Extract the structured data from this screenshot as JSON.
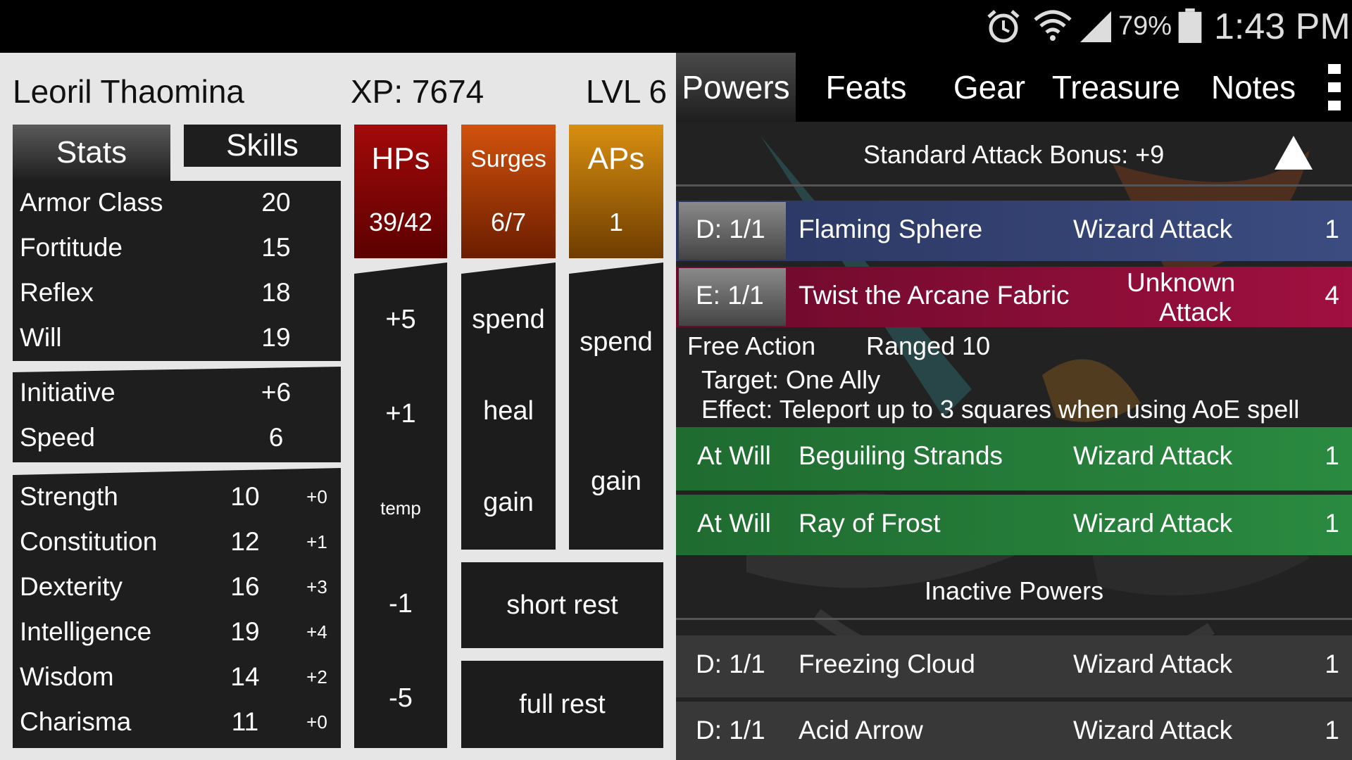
{
  "status_bar": {
    "battery_percent": "79%",
    "time": "1:43 PM",
    "icons": [
      "alarm-icon",
      "wifi-icon",
      "signal-icon",
      "battery-icon"
    ]
  },
  "character": {
    "name": "Leoril Thaomina",
    "xp": "XP: 7674",
    "level": "LVL 6"
  },
  "left_tabs": {
    "stats": "Stats",
    "skills": "Skills"
  },
  "defenses": [
    {
      "label": "Armor Class",
      "value": "20"
    },
    {
      "label": "Fortitude",
      "value": "15"
    },
    {
      "label": "Reflex",
      "value": "18"
    },
    {
      "label": "Will",
      "value": "19"
    }
  ],
  "movement": [
    {
      "label": "Initiative",
      "value": "+6"
    },
    {
      "label": "Speed",
      "value": "6"
    }
  ],
  "abilities": [
    {
      "label": "Strength",
      "value": "10",
      "mod": "+0"
    },
    {
      "label": "Constitution",
      "value": "12",
      "mod": "+1"
    },
    {
      "label": "Dexterity",
      "value": "16",
      "mod": "+3"
    },
    {
      "label": "Intelligence",
      "value": "19",
      "mod": "+4"
    },
    {
      "label": "Wisdom",
      "value": "14",
      "mod": "+2"
    },
    {
      "label": "Charisma",
      "value": "11",
      "mod": "+0"
    }
  ],
  "trackers": {
    "hps": {
      "label": "HPs",
      "value": "39/42",
      "color_top": "#a30a0a",
      "color_bottom": "#5c0000"
    },
    "surges": {
      "label": "Surges",
      "value": "6/7",
      "color_top": "#d2520c",
      "color_bottom": "#6b1d00"
    },
    "aps": {
      "label": "APs",
      "value": "1",
      "color_top": "#d88f10",
      "color_bottom": "#6e3c00"
    }
  },
  "hp_buttons": [
    "+5",
    "+1",
    "temp",
    "-1",
    "-5"
  ],
  "surge_buttons": [
    "spend",
    "heal",
    "gain"
  ],
  "ap_buttons": [
    "spend",
    "gain"
  ],
  "rest_buttons": {
    "short": "short rest",
    "full": "full rest"
  },
  "right_tabs": [
    "Powers",
    "Feats",
    "Gear",
    "Treasure",
    "Notes"
  ],
  "attack_bonus": "Standard Attack Bonus:  +9",
  "powers": [
    {
      "usage": "D:  1/1",
      "name": "Flaming Sphere",
      "type": "Wizard Attack",
      "count": "1",
      "color": "#2f3f6f"
    },
    {
      "usage": "E:  1/1",
      "name": "Twist the Arcane Fabric",
      "type_line1": "Unknown",
      "type_line2": "Attack",
      "count": "4",
      "color": "#8a0f3a"
    }
  ],
  "expanded_power": {
    "action": "Free Action",
    "range": "Ranged 10",
    "target": "Target: One Ally",
    "effect": "Effect: Teleport up to 3 squares when using AoE spell"
  },
  "at_will_powers": [
    {
      "usage": "At Will",
      "name": "Beguiling Strands",
      "type": "Wizard Attack",
      "count": "1"
    },
    {
      "usage": "At Will",
      "name": "Ray of Frost",
      "type": "Wizard Attack",
      "count": "1"
    }
  ],
  "inactive_header": "Inactive Powers",
  "inactive_powers": [
    {
      "usage": "D:  1/1",
      "name": "Freezing Cloud",
      "type": "Wizard Attack",
      "count": "1"
    },
    {
      "usage": "D:  1/1",
      "name": "Acid Arrow",
      "type": "Wizard Attack",
      "count": "1"
    }
  ]
}
